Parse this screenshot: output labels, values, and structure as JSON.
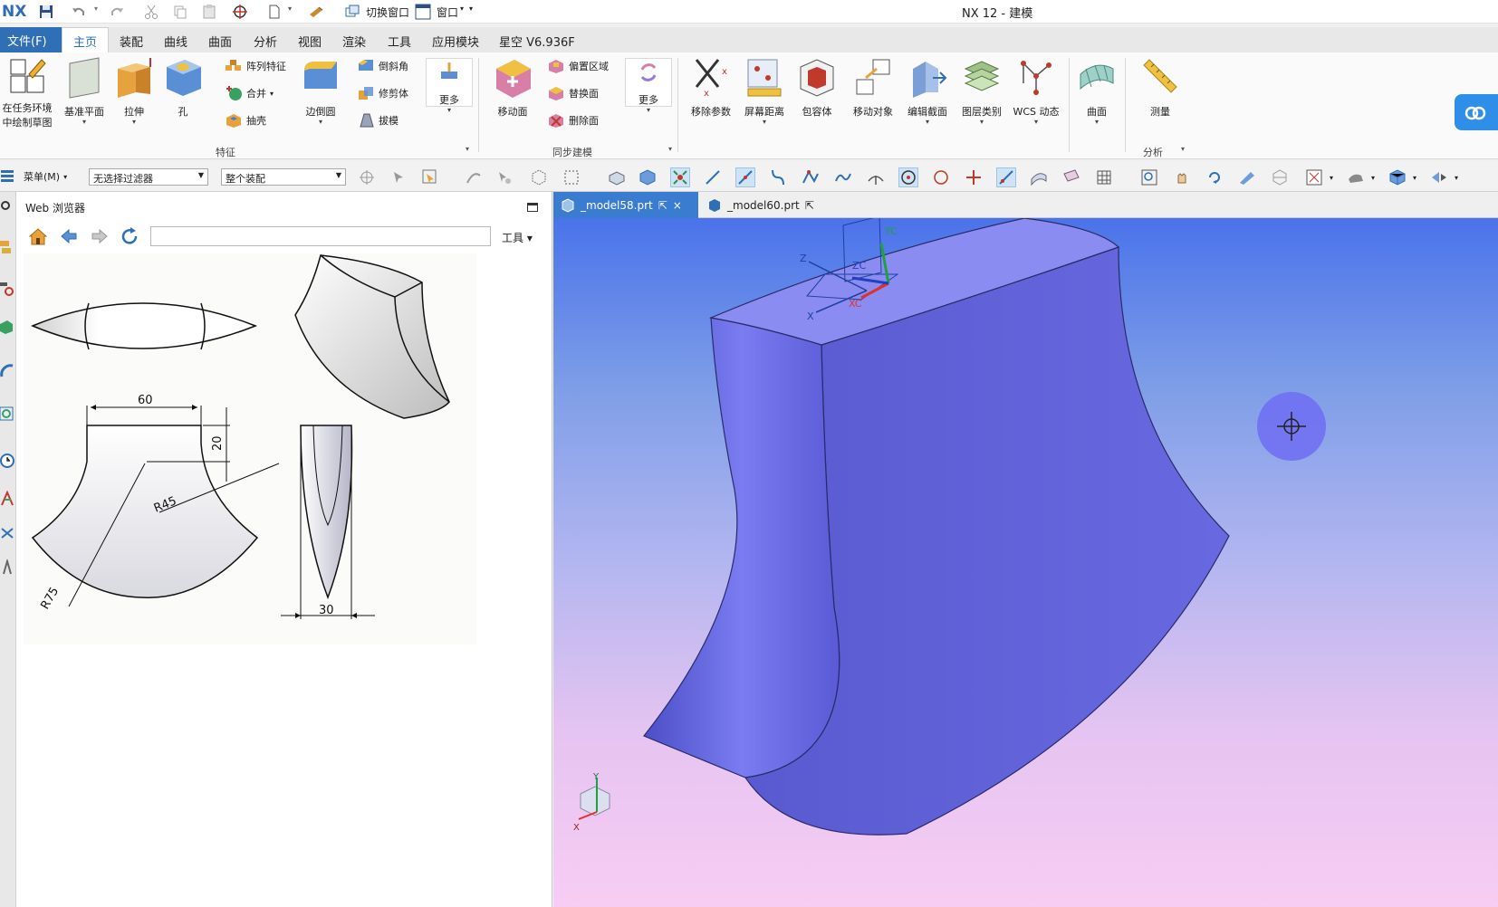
{
  "app": {
    "logo": "NX",
    "title": "NX 12 - 建模"
  },
  "quick_access": {
    "switch_window": "切换窗口",
    "window": "窗口"
  },
  "menu_tabs": {
    "file": "文件(F)",
    "items": [
      "主页",
      "装配",
      "曲线",
      "曲面",
      "分析",
      "视图",
      "渲染",
      "工具",
      "应用模块",
      "星空 V6.936F"
    ],
    "active": "主页"
  },
  "ribbon": {
    "sketch_line1": "在任务环境",
    "sketch_line2": "中绘制草图",
    "datum_plane": "基准平面",
    "extrude": "拉伸",
    "hole": "孔",
    "pattern_feature": "阵列特征",
    "unite": "合并",
    "shell": "抽壳",
    "edge_blend": "边倒圆",
    "chamfer": "倒斜角",
    "trim_body": "修剪体",
    "draft": "拔模",
    "more1": "更多",
    "move_face": "移动面",
    "offset_region": "偏置区域",
    "replace_face": "替换面",
    "delete_face": "删除面",
    "more2": "更多",
    "remove_params": "移除参数",
    "screen_distance": "屏幕距离",
    "bounding_body": "包容体",
    "move_object": "移动对象",
    "edit_section": "编辑截面",
    "layer_category": "图层类别",
    "wcs_dynamic": "WCS 动态",
    "surface": "曲面",
    "measure": "测量",
    "group_feature": "特征",
    "group_sync": "同步建模",
    "group_analysis": "分析"
  },
  "selection_bar": {
    "menu": "菜单(M)",
    "filter": "无选择过滤器",
    "scope": "整个装配"
  },
  "web_browser": {
    "title": "Web 浏览器",
    "url": "",
    "tools": "工具",
    "dims": {
      "width": "60",
      "height": "20",
      "r45": "R45",
      "r75": "R75",
      "thick": "30"
    }
  },
  "graphics": {
    "tabs": [
      {
        "name": "_model58.prt",
        "active": true
      },
      {
        "name": "_model60.prt",
        "active": false
      }
    ],
    "wcs_labels": {
      "yc": "YC",
      "zc": "ZC",
      "xc": "XC",
      "z": "Z",
      "x": "X"
    },
    "triad_labels": {
      "y": "Y",
      "x": "X"
    },
    "colors": {
      "solid_face": "#6366df",
      "solid_top": "#8d8ff5",
      "accent_blue": "#2f6fb5"
    }
  }
}
